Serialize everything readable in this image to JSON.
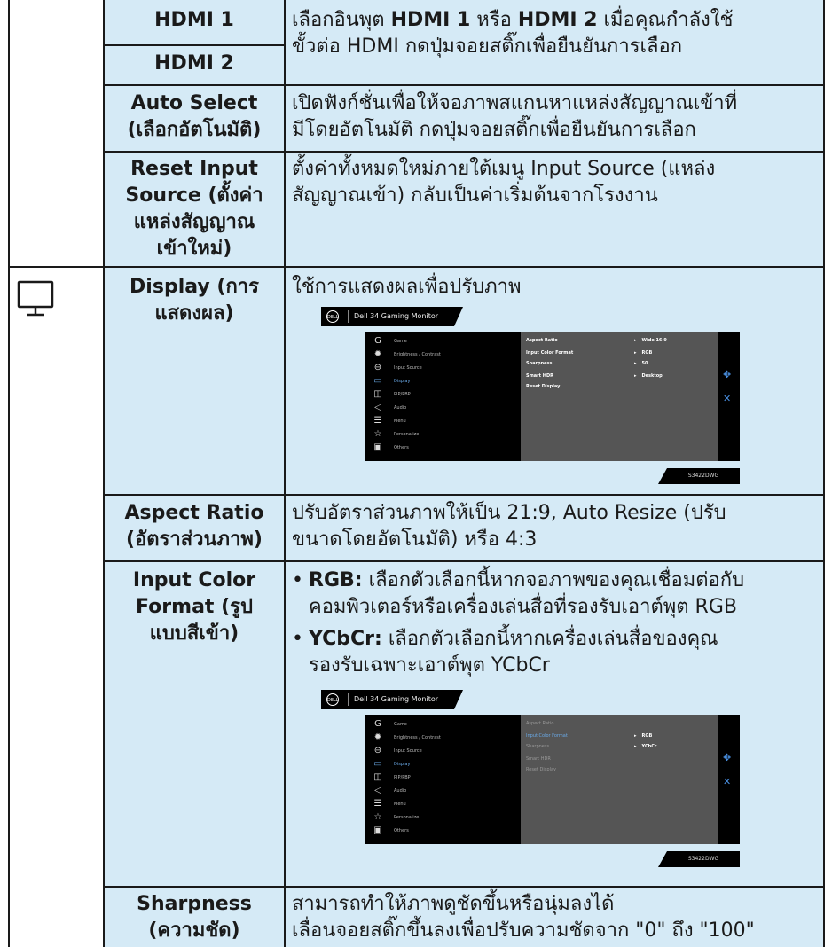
{
  "rows": {
    "hdmi1": {
      "label": "HDMI 1"
    },
    "hdmi2": {
      "label": "HDMI 2"
    },
    "hdmi_desc": {
      "l1a": "เลือกอินพุต ",
      "l1b": "HDMI 1",
      "l1c": " หรือ ",
      "l1d": "HDMI 2",
      "l1e": " เมื่อคุณกำลังใช้",
      "l2": "ขั้วต่อ HDMI กดปุ่มจอยสติ๊กเพื่อยืนยันการเลือก"
    },
    "auto_select": {
      "label_l1": "Auto Select",
      "label_l2": "(เลือกอัตโนมัติ)",
      "desc_l1": "เปิดฟังก์ชั่นเพื่อให้จอภาพสแกนหาแหล่งสัญญาณเข้าที่",
      "desc_l2": "มีโดยอัตโนมัติ กดปุ่มจอยสติ๊กเพื่อยืนยันการเลือก"
    },
    "reset_input": {
      "label_l1": "Reset Input",
      "label_l2": "Source (ตั้งค่า",
      "label_l3": "แหล่งสัญญาณ",
      "label_l4": "เข้าใหม่)",
      "desc_l1": "ตั้งค่าทั้งหมดใหม่ภายใต้เมนู Input Source (แหล่ง",
      "desc_l2": "สัญญาณเข้า) กลับเป็นค่าเริ่มต้นจากโรงงาน"
    },
    "display": {
      "label_l1": "Display (การ",
      "label_l2": "แสดงผล)",
      "desc": "ใช้การแสดงผลเพื่อปรับภาพ"
    },
    "aspect": {
      "label_l1": "Aspect Ratio",
      "label_l2": "(อัตราส่วนภาพ)",
      "desc_l1": "ปรับอัตราส่วนภาพให้เป็น 21:9, Auto Resize (ปรับ",
      "desc_l2": "ขนาดโดยอัตโนมัติ) หรือ 4:3"
    },
    "input_color": {
      "label_l1": "Input Color",
      "label_l2": "Format (รูป",
      "label_l3": "แบบสีเข้า)",
      "b1_key": "RGB:",
      "b1_l1": " เลือกตัวเลือกนี้หากจอภาพของคุณเชื่อมต่อกับ",
      "b1_l2": "คอมพิวเตอร์หรือเครื่องเล่นสื่อที่รองรับเอาต์พุต RGB",
      "b2_key": "YCbCr:",
      "b2_l1": " เลือกตัวเลือกนี้หากเครื่องเล่นสื่อของคุณ",
      "b2_l2": "รองรับเฉพาะเอาต์พุต YCbCr"
    },
    "sharpness": {
      "label_l1": "Sharpness",
      "label_l2": "(ความชัด)",
      "desc_l1": "สามารถทำให้ภาพดูชัดขึ้นหรือนุ่มลงได้",
      "desc_l2": "เลื่อนจอยสติ๊กขึ้นลงเพื่อปรับความชัดจาก \"0\" ถึง \"100\""
    }
  },
  "osd": {
    "logo": "DELL",
    "title": "Dell 34 Gaming Monitor",
    "model": "S3422DWG",
    "menu": [
      "Game",
      "Brightness / Contrast",
      "Input Source",
      "Display",
      "PIP/PBP",
      "Audio",
      "Menu",
      "Personalize",
      "Others"
    ],
    "icons": [
      "game-icon",
      "brightness-icon",
      "input-source-icon",
      "display-icon",
      "pip-pbp-icon",
      "audio-icon",
      "menu-icon",
      "personalize-icon",
      "others-icon"
    ],
    "settings": [
      "Aspect Ratio",
      "Input Color Format",
      "Sharpness",
      "Smart HDR",
      "Reset Display"
    ],
    "values1": [
      "Wide 16:9",
      "RGB",
      "50",
      "Desktop"
    ],
    "values2": [
      "RGB",
      "YCbCr"
    ],
    "accent": "#6aa9e6"
  }
}
